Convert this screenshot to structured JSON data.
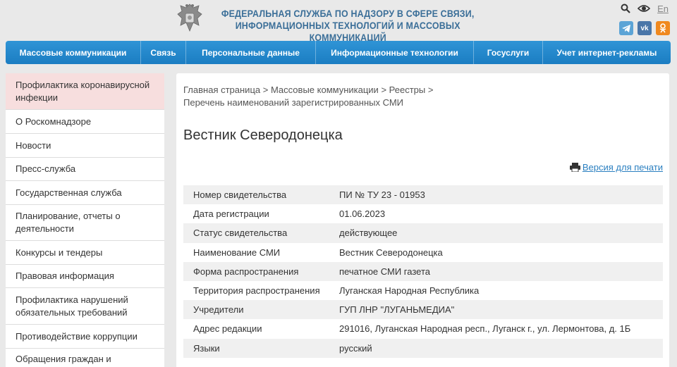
{
  "header": {
    "title_line1": "ФЕДЕРАЛЬНАЯ СЛУЖБА ПО НАДЗОРУ В СФЕРЕ СВЯЗИ,",
    "title_line2": "ИНФОРМАЦИОННЫХ ТЕХНОЛОГИЙ И МАССОВЫХ КОММУНИКАЦИЙ",
    "lang": "En",
    "icons": [
      "search-icon",
      "eye-icon"
    ],
    "social": [
      {
        "name": "telegram-icon",
        "glyph": "✈",
        "color": "#5ca4d6"
      },
      {
        "name": "vk-icon",
        "glyph": "vk",
        "color": "#4a76a8"
      },
      {
        "name": "ok-icon",
        "glyph": "ok",
        "color": "#f0891f"
      }
    ]
  },
  "nav": {
    "items": [
      {
        "label": "Массовые коммуникации"
      },
      {
        "label": "Связь"
      },
      {
        "label": "Персональные данные"
      },
      {
        "label": "Информационные технологии"
      },
      {
        "label": "Госуслуги"
      },
      {
        "label": "Учет интернет-рекламы"
      }
    ]
  },
  "sidebar": {
    "items": [
      {
        "label": "Профилактика коронавирусной инфекции"
      },
      {
        "label": "О Роскомнадзоре"
      },
      {
        "label": "Новости"
      },
      {
        "label": "Пресс-служба"
      },
      {
        "label": "Государственная служба"
      },
      {
        "label": "Планирование, отчеты о деятельности"
      },
      {
        "label": "Конкурсы и тендеры"
      },
      {
        "label": "Правовая информация"
      },
      {
        "label": "Профилактика нарушений обязательных требований"
      },
      {
        "label": "Противодействие коррупции"
      },
      {
        "label": "Обращения граждан и"
      }
    ]
  },
  "breadcrumb": {
    "items": [
      "Главная страница",
      "Массовые коммуникации",
      "Реестры",
      "Перечень наименований зарегистрированных СМИ"
    ],
    "separator": " > "
  },
  "main": {
    "title": "Вестник Северодонецка",
    "print_label": "Версия для печати",
    "rows": [
      {
        "key": "Номер свидетельства",
        "value": "ПИ № ТУ 23 - 01953"
      },
      {
        "key": "Дата регистрации",
        "value": "01.06.2023"
      },
      {
        "key": "Статус свидетельства",
        "value": "действующее"
      },
      {
        "key": "Наименование СМИ",
        "value": "Вестник Северодонецка"
      },
      {
        "key": "Форма распространения",
        "value": "печатное СМИ газета"
      },
      {
        "key": "Территория распространения",
        "value": "Луганская Народная Республика"
      },
      {
        "key": "Учредители",
        "value": "ГУП ЛНР \"ЛУГАНЬМЕДИА\""
      },
      {
        "key": "Адрес редакции",
        "value": "291016, Луганская Народная респ., Луганск г., ул. Лермонтова, д. 1Б"
      },
      {
        "key": "Языки",
        "value": "русский"
      }
    ]
  },
  "colors": {
    "nav_bg": "#1b7dc2",
    "title_blue": "#3a6e98",
    "link_blue": "#2a7fc0",
    "active_side": "#f7dede"
  }
}
